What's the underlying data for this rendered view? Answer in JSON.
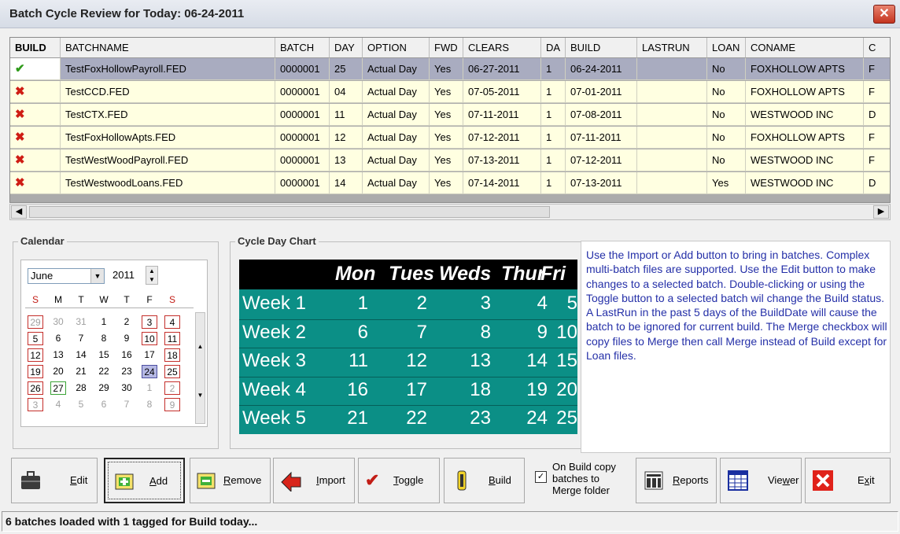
{
  "window": {
    "title": "Batch Cycle Review for Today: 06-24-2011",
    "close_glyph": "✕"
  },
  "grid": {
    "columns": [
      "BUILD",
      "BATCHNAME",
      "BATCH",
      "DAY",
      "OPTION",
      "FWD",
      "CLEARS",
      "DA",
      "BUILD",
      "LASTRUN",
      "LOAN",
      "CONAME",
      "C"
    ],
    "rows": [
      {
        "build": "✔",
        "build_state": "yes",
        "batchname": "TestFoxHollowPayroll.FED",
        "batch": "0000001",
        "day": "25",
        "option": "Actual Day",
        "fwd": "Yes",
        "clears": "06-27-2011",
        "da": "1",
        "builddate": "06-24-2011",
        "lastrun": "",
        "loan": "No",
        "coname": "FOXHOLLOW APTS",
        "extra": "F"
      },
      {
        "build": "✖",
        "build_state": "no",
        "batchname": "TestCCD.FED",
        "batch": "0000001",
        "day": "04",
        "option": "Actual Day",
        "fwd": "Yes",
        "clears": "07-05-2011",
        "da": "1",
        "builddate": "07-01-2011",
        "lastrun": "",
        "loan": "No",
        "coname": "FOXHOLLOW APTS",
        "extra": "F"
      },
      {
        "build": "✖",
        "build_state": "no",
        "batchname": "TestCTX.FED",
        "batch": "0000001",
        "day": "11",
        "option": "Actual Day",
        "fwd": "Yes",
        "clears": "07-11-2011",
        "da": "1",
        "builddate": "07-08-2011",
        "lastrun": "",
        "loan": "No",
        "coname": "WESTWOOD INC",
        "extra": "D"
      },
      {
        "build": "✖",
        "build_state": "no",
        "batchname": "TestFoxHollowApts.FED",
        "batch": "0000001",
        "day": "12",
        "option": "Actual Day",
        "fwd": "Yes",
        "clears": "07-12-2011",
        "da": "1",
        "builddate": "07-11-2011",
        "lastrun": "",
        "loan": "No",
        "coname": "FOXHOLLOW APTS",
        "extra": "F"
      },
      {
        "build": "✖",
        "build_state": "no",
        "batchname": "TestWestWoodPayroll.FED",
        "batch": "0000001",
        "day": "13",
        "option": "Actual Day",
        "fwd": "Yes",
        "clears": "07-13-2011",
        "da": "1",
        "builddate": "07-12-2011",
        "lastrun": "",
        "loan": "No",
        "coname": "WESTWOOD INC",
        "extra": "F"
      },
      {
        "build": "✖",
        "build_state": "no",
        "batchname": "TestWestwoodLoans.FED",
        "batch": "0000001",
        "day": "14",
        "option": "Actual Day",
        "fwd": "Yes",
        "clears": "07-14-2011",
        "da": "1",
        "builddate": "07-13-2011",
        "lastrun": "",
        "loan": "Yes",
        "coname": "WESTWOOD INC",
        "extra": "D"
      }
    ],
    "selected_row": 0
  },
  "calendar": {
    "legend": "Calendar",
    "month": "June",
    "year": "2011",
    "dow": [
      "S",
      "M",
      "T",
      "W",
      "T",
      "F",
      "S"
    ],
    "weeks": [
      [
        "29",
        "30",
        "31",
        "1",
        "2",
        "3",
        "4"
      ],
      [
        "5",
        "6",
        "7",
        "8",
        "9",
        "10",
        "11"
      ],
      [
        "12",
        "13",
        "14",
        "15",
        "16",
        "17",
        "18"
      ],
      [
        "19",
        "20",
        "21",
        "22",
        "23",
        "24",
        "25"
      ],
      [
        "26",
        "27",
        "28",
        "29",
        "30",
        "1",
        "2"
      ],
      [
        "3",
        "4",
        "5",
        "6",
        "7",
        "8",
        "9"
      ]
    ],
    "today": "24",
    "marked_today_green": "27"
  },
  "cycle_chart": {
    "legend": "Cycle Day Chart",
    "days": [
      "Mon",
      "Tues",
      "Weds",
      "Thur",
      "Fri"
    ],
    "weeks": [
      {
        "label": "Week 1",
        "values": [
          "1",
          "2",
          "3",
          "4",
          "5"
        ]
      },
      {
        "label": "Week 2",
        "values": [
          "6",
          "7",
          "8",
          "9",
          "10"
        ]
      },
      {
        "label": "Week 3",
        "values": [
          "11",
          "12",
          "13",
          "14",
          "15"
        ]
      },
      {
        "label": "Week 4",
        "values": [
          "16",
          "17",
          "18",
          "19",
          "20"
        ]
      },
      {
        "label": "Week 5",
        "values": [
          "21",
          "22",
          "23",
          "24",
          "25"
        ]
      }
    ]
  },
  "help_text": "Use the Import or Add button to bring in batches. Complex multi-batch files are supported. Use the Edit button to make changes to a selected batch. Double-clicking or using the Toggle button to a selected batch wil change the Build status. A LastRun in the past 5 days of the BuildDate will cause the batch to be ignored for current build. The Merge checkbox will copy files to Merge then call Merge instead of Build except for Loan files.",
  "toolbar": {
    "edit": {
      "pre": "",
      "key": "E",
      "post": "dit"
    },
    "add": {
      "pre": "",
      "key": "A",
      "post": "dd"
    },
    "remove": {
      "pre": "",
      "key": "R",
      "post": "emove"
    },
    "import": {
      "pre": "",
      "key": "I",
      "post": "mport"
    },
    "toggle": {
      "pre": "",
      "key": "T",
      "post": "oggle"
    },
    "build": {
      "pre": "",
      "key": "B",
      "post": "uild"
    },
    "merge_checkbox": {
      "line1": "On Build copy",
      "line2": "batches to",
      "line3": "Merge folder",
      "checked": true
    },
    "reports": {
      "pre": "",
      "key": "R",
      "post": "eports"
    },
    "viewer": {
      "pre": "Vie",
      "key": "w",
      "post": "er"
    },
    "exit": {
      "pre": "E",
      "key": "x",
      "post": "it"
    }
  },
  "status": {
    "pre": "6 batches loaded with ",
    "count": "1",
    "post": " tagged for Build today..."
  },
  "colors": {
    "row_bg": "#ffffe1",
    "row_selected_bg": "#a9acc0",
    "chart_teal": "#0b8f86",
    "help_text": "#2530a8",
    "tag_red": "#cf1d14",
    "tag_green": "#2e9a1a"
  }
}
